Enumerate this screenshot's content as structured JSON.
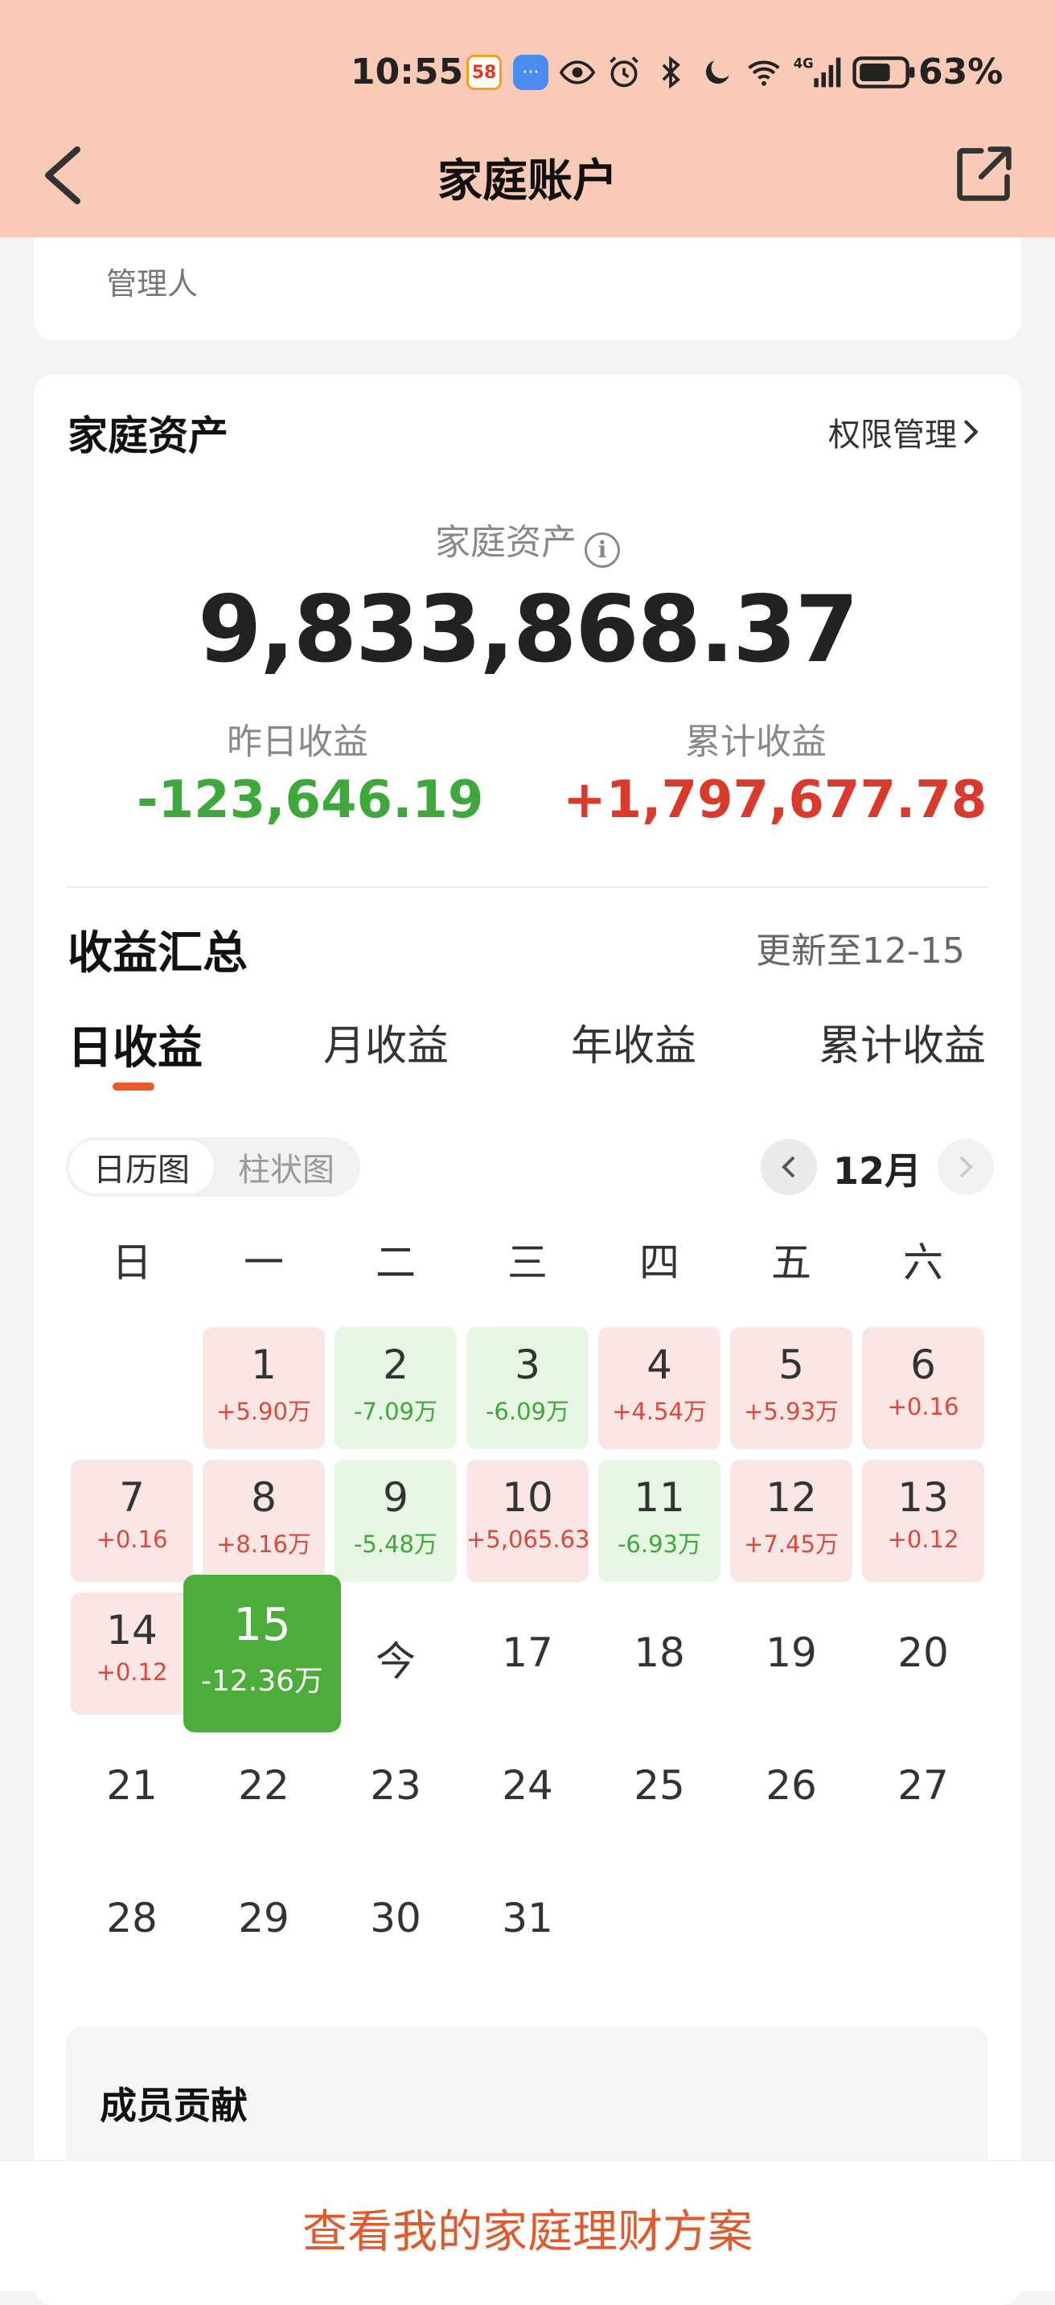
{
  "status_bar": {
    "time": "10:55",
    "app_badge_58": "58",
    "network": "4G",
    "battery": "63%",
    "icons": [
      "58-app-icon",
      "message-icon",
      "eye-icon",
      "alarm-icon",
      "bluetooth-icon",
      "moon-icon",
      "wifi-icon",
      "signal-icon",
      "battery-icon"
    ]
  },
  "header": {
    "title": "家庭账户"
  },
  "top_card": {
    "role": "管理人"
  },
  "assets": {
    "section_title": "家庭资产",
    "permission_link": "权限管理",
    "label": "家庭资产",
    "info_glyph": "i",
    "value": "9,833,868.37",
    "yesterday_label": "昨日收益",
    "yesterday_value": "-123,646.19",
    "cumulative_label": "累计收益",
    "cumulative_value": "+1,797,677.78"
  },
  "summary": {
    "title": "收益汇总",
    "updated": "更新至12-15",
    "tabs": [
      "日收益",
      "月收益",
      "年收益",
      "累计收益"
    ],
    "view_toggle": [
      "日历图",
      "柱状图"
    ],
    "month": "12月"
  },
  "calendar": {
    "weekdays": [
      "日",
      "一",
      "二",
      "三",
      "四",
      "五",
      "六"
    ],
    "days": [
      {
        "d": "1",
        "v": "+5.90万",
        "t": "pos"
      },
      {
        "d": "2",
        "v": "-7.09万",
        "t": "neg"
      },
      {
        "d": "3",
        "v": "-6.09万",
        "t": "neg"
      },
      {
        "d": "4",
        "v": "+4.54万",
        "t": "pos"
      },
      {
        "d": "5",
        "v": "+5.93万",
        "t": "pos"
      },
      {
        "d": "6",
        "v": "+0.16",
        "t": "pos"
      },
      {
        "d": "7",
        "v": "+0.16",
        "t": "pos"
      },
      {
        "d": "8",
        "v": "+8.16万",
        "t": "pos"
      },
      {
        "d": "9",
        "v": "-5.48万",
        "t": "neg"
      },
      {
        "d": "10",
        "v": "+5,065.63",
        "t": "pos"
      },
      {
        "d": "11",
        "v": "-6.93万",
        "t": "neg"
      },
      {
        "d": "12",
        "v": "+7.45万",
        "t": "pos"
      },
      {
        "d": "13",
        "v": "+0.12",
        "t": "pos"
      },
      {
        "d": "14",
        "v": "+0.12",
        "t": "pos"
      },
      {
        "d": "15",
        "v": "-12.36万",
        "t": "sel"
      },
      {
        "d": "今",
        "v": "",
        "t": "plain"
      },
      {
        "d": "17",
        "v": "",
        "t": "plain"
      },
      {
        "d": "18",
        "v": "",
        "t": "plain"
      },
      {
        "d": "19",
        "v": "",
        "t": "plain"
      },
      {
        "d": "20",
        "v": "",
        "t": "plain"
      },
      {
        "d": "21",
        "v": "",
        "t": "plain"
      },
      {
        "d": "22",
        "v": "",
        "t": "plain"
      },
      {
        "d": "23",
        "v": "",
        "t": "plain"
      },
      {
        "d": "24",
        "v": "",
        "t": "plain"
      },
      {
        "d": "25",
        "v": "",
        "t": "plain"
      },
      {
        "d": "26",
        "v": "",
        "t": "plain"
      },
      {
        "d": "27",
        "v": "",
        "t": "plain"
      },
      {
        "d": "28",
        "v": "",
        "t": "plain"
      },
      {
        "d": "29",
        "v": "",
        "t": "plain"
      },
      {
        "d": "30",
        "v": "",
        "t": "plain"
      },
      {
        "d": "31",
        "v": "",
        "t": "plain"
      }
    ]
  },
  "members": {
    "title": "成员贡献"
  },
  "bottom": {
    "button": "查看我的家庭理财方案"
  },
  "colors": {
    "header_bg": "#f9cbb7",
    "accent": "#e05a2c",
    "positive": "#d93a2b",
    "negative": "#3fa83c"
  }
}
